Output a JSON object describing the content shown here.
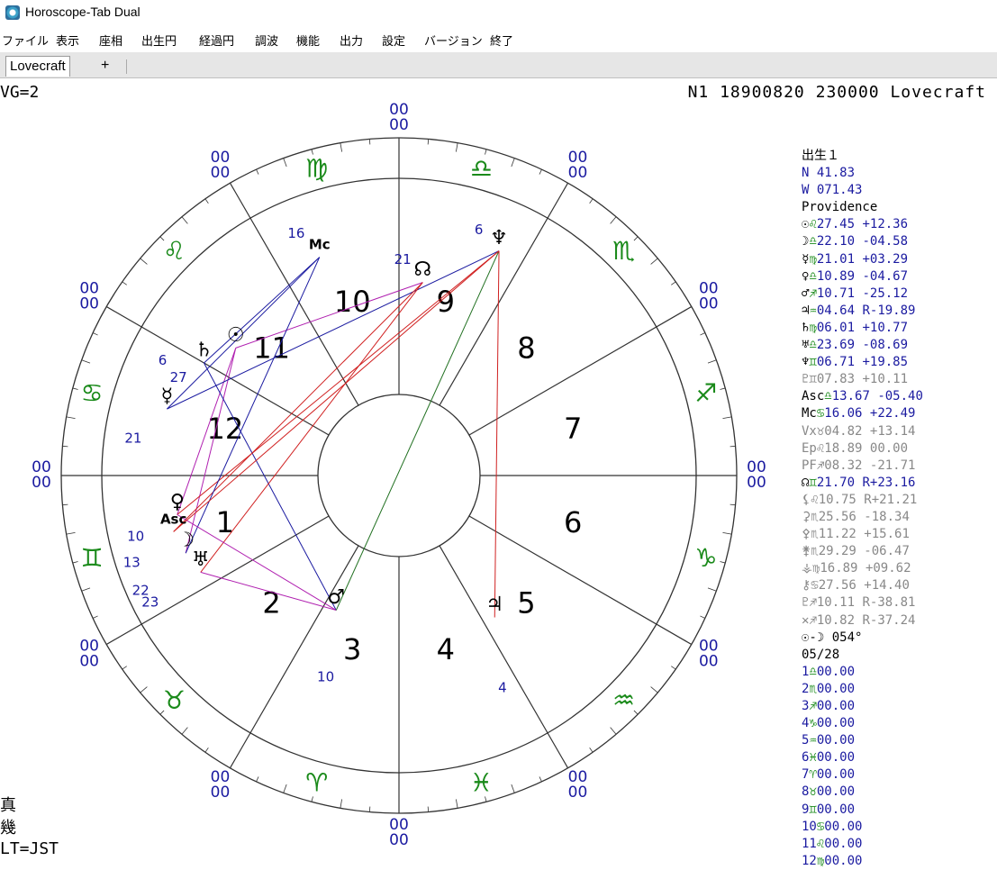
{
  "window": {
    "title": "Horoscope-Tab Dual",
    "icon": "app-icon"
  },
  "menu": [
    "ファイル",
    "表示",
    "座相",
    "出生円",
    "経過円",
    "調波",
    "機能",
    "出力",
    "設定",
    "バージョン",
    "終了"
  ],
  "tabs": {
    "active": "Lovecraft",
    "add": "+"
  },
  "header": {
    "left": "VG=2",
    "right": "N1 18900820 230000 Lovecraft"
  },
  "colors": {
    "blue": "#1a1aa0",
    "green": "#1a8a1a",
    "magenta": "#b020b0",
    "red": "#d02020",
    "darkgreen": "#207020",
    "gray": "#888888",
    "line": "#333333"
  },
  "chart": {
    "ring_labels": [
      "00",
      "00"
    ],
    "houses": [
      "1",
      "2",
      "3",
      "4",
      "5",
      "6",
      "7",
      "8",
      "9",
      "10",
      "11",
      "12"
    ],
    "zodiac": [
      "♌",
      "♋",
      "♊",
      "♉",
      "♈",
      "♓",
      "♒",
      "♑",
      "♐",
      "♏",
      "♎",
      "♍"
    ],
    "planets": [
      {
        "glyph": "☉",
        "deg": "27"
      },
      {
        "glyph": "♄",
        "deg": "6"
      },
      {
        "glyph": "☿",
        "deg": "21"
      },
      {
        "glyph": "♀",
        "deg": "10"
      },
      {
        "glyph": "Asc",
        "deg": "13"
      },
      {
        "glyph": "☽",
        "deg": "22"
      },
      {
        "glyph": "♅",
        "deg": "23"
      },
      {
        "glyph": "♂",
        "deg": "10"
      },
      {
        "glyph": "♃",
        "deg": "4"
      },
      {
        "glyph": "♆",
        "deg": "6"
      },
      {
        "glyph": "☊",
        "deg": "21"
      },
      {
        "glyph": "Mc",
        "deg": "16"
      }
    ]
  },
  "sidebar": {
    "header": [
      "出生１",
      "N  41.83",
      "W 071.43",
      "Providence"
    ],
    "bodies": [
      {
        "sym": "☉",
        "sign": "♌",
        "pos": "27.45",
        "val": "+12.36",
        "muted": false
      },
      {
        "sym": "☽",
        "sign": "♎",
        "pos": "22.10",
        "val": "-04.58",
        "muted": false
      },
      {
        "sym": "☿",
        "sign": "♍",
        "pos": "21.01",
        "val": "+03.29",
        "muted": false
      },
      {
        "sym": "♀",
        "sign": "♎",
        "pos": "10.89",
        "val": "-04.67",
        "muted": false
      },
      {
        "sym": "♂",
        "sign": "♐",
        "pos": "10.71",
        "val": "-25.12",
        "muted": false
      },
      {
        "sym": "♃",
        "sign": "♒",
        "pos": "04.64",
        "val": "R-19.89",
        "muted": false
      },
      {
        "sym": "♄",
        "sign": "♍",
        "pos": "06.01",
        "val": "+10.77",
        "muted": false
      },
      {
        "sym": "♅",
        "sign": "♎",
        "pos": "23.69",
        "val": "-08.69",
        "muted": false
      },
      {
        "sym": "♆",
        "sign": "♊",
        "pos": "06.71",
        "val": "+19.85",
        "muted": false
      },
      {
        "sym": "♇",
        "sign": "♊",
        "pos": "07.83",
        "val": "+10.11",
        "muted": true
      },
      {
        "sym": "Asc",
        "sign": "♎",
        "pos": "13.67",
        "val": "-05.40",
        "muted": false
      },
      {
        "sym": "Mc",
        "sign": "♋",
        "pos": "16.06",
        "val": "+22.49",
        "muted": false
      },
      {
        "sym": "Vx",
        "sign": "♉",
        "pos": "04.82",
        "val": "+13.14",
        "muted": true
      },
      {
        "sym": "Ep",
        "sign": "♌",
        "pos": "18.89",
        "val": "00.00",
        "muted": true
      },
      {
        "sym": "PF",
        "sign": "♐",
        "pos": "08.32",
        "val": "-21.71",
        "muted": true
      },
      {
        "sym": "☊",
        "sign": "♊",
        "pos": "21.70",
        "val": "R+23.16",
        "muted": false
      },
      {
        "sym": "⚸",
        "sign": "♌",
        "pos": "10.75",
        "val": "R+21.21",
        "muted": true
      },
      {
        "sym": "⚳",
        "sign": "♏",
        "pos": "25.56",
        "val": "-18.34",
        "muted": true
      },
      {
        "sym": "⚴",
        "sign": "♏",
        "pos": "11.22",
        "val": "+15.61",
        "muted": true
      },
      {
        "sym": "⚵",
        "sign": "♏",
        "pos": "29.29",
        "val": "-06.47",
        "muted": true
      },
      {
        "sym": "⚶",
        "sign": "♍",
        "pos": "16.89",
        "val": "+09.62",
        "muted": true
      },
      {
        "sym": "⚷",
        "sign": "♋",
        "pos": "27.56",
        "val": "+14.40",
        "muted": true
      },
      {
        "sym": "♇",
        "sign": "♐",
        "pos": "10.11",
        "val": "R-38.81",
        "muted": true
      },
      {
        "sym": "✕",
        "sign": "♐",
        "pos": "10.82",
        "val": "R-37.24",
        "muted": true
      }
    ],
    "phase": "☉-☽ 054°",
    "date": "05/28",
    "cusps": [
      {
        "n": " 1",
        "sign": "♎",
        "pos": "00.00"
      },
      {
        "n": " 2",
        "sign": "♏",
        "pos": "00.00"
      },
      {
        "n": " 3",
        "sign": "♐",
        "pos": "00.00"
      },
      {
        "n": " 4",
        "sign": "♑",
        "pos": "00.00"
      },
      {
        "n": " 5",
        "sign": "♒",
        "pos": "00.00"
      },
      {
        "n": " 6",
        "sign": "♓",
        "pos": "00.00"
      },
      {
        "n": " 7",
        "sign": "♈",
        "pos": "00.00"
      },
      {
        "n": " 8",
        "sign": "♉",
        "pos": "00.00"
      },
      {
        "n": " 9",
        "sign": "♊",
        "pos": "00.00"
      },
      {
        "n": "10",
        "sign": "♋",
        "pos": "00.00"
      },
      {
        "n": "11",
        "sign": "♌",
        "pos": "00.00"
      },
      {
        "n": "12",
        "sign": "♍",
        "pos": "00.00"
      }
    ]
  },
  "bottom_left": [
    "真",
    "幾",
    "LT=JST"
  ]
}
